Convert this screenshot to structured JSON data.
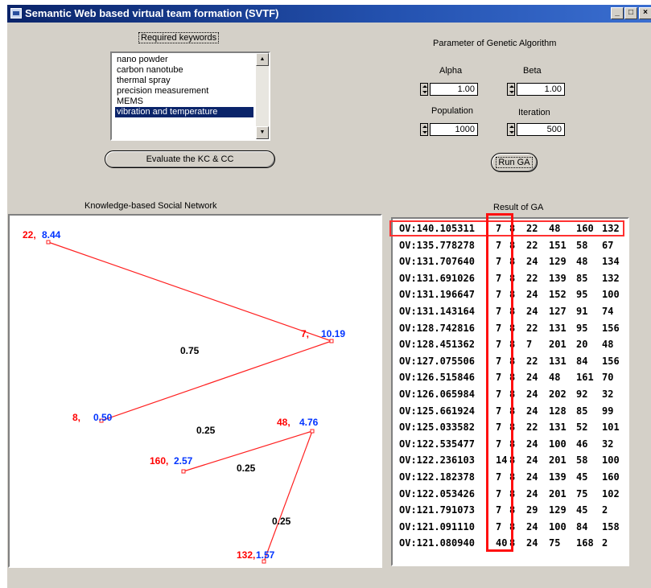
{
  "window": {
    "title": "Semantic Web based virtual team formation (SVTF)",
    "controls": {
      "minimize": "_",
      "maximize": "□",
      "close": "×"
    }
  },
  "keywords": {
    "label": "Required keywords",
    "items": [
      "nano powder",
      "carbon nanotube",
      "thermal spray",
      "precision measurement",
      "MEMS",
      "vibration and temperature"
    ],
    "selected_index": 5
  },
  "evaluate_button": "Evaluate the KC & CC",
  "ga_params": {
    "title": "Parameter of Genetic Algorithm",
    "alpha_label": "Alpha",
    "alpha_value": "1.00",
    "beta_label": "Beta",
    "beta_value": "1.00",
    "population_label": "Population",
    "population_value": "1000",
    "iteration_label": "Iteration",
    "iteration_value": "500"
  },
  "run_button": "Run GA",
  "network": {
    "title": "Knowledge-based Social Network",
    "colors": {
      "edge": "#ff2020",
      "id": "#ff0000",
      "score": "#0033ff",
      "weight": "#000000"
    },
    "nodes": [
      {
        "id": "22,",
        "score": "8.44"
      },
      {
        "id": "7,",
        "score": "10.19"
      },
      {
        "id": "8,",
        "score": "0.50"
      },
      {
        "id": "48,",
        "score": "4.76"
      },
      {
        "id": "160,",
        "score": "2.57"
      },
      {
        "id": "132,",
        "score": "1.57"
      }
    ],
    "edges": [
      {
        "from": 0,
        "to": 1,
        "weight": "0.75"
      },
      {
        "from": 1,
        "to": 2,
        "weight": "0.25"
      },
      {
        "from": 3,
        "to": 4,
        "weight": "0.25"
      },
      {
        "from": 3,
        "to": 5,
        "weight": "0.25"
      }
    ]
  },
  "results": {
    "title": "Result of GA",
    "rows": [
      [
        "OV:140.105311",
        "7",
        "8",
        "22",
        "48",
        "160",
        "132"
      ],
      [
        "OV:135.778278",
        "7",
        "8",
        "22",
        "151",
        "58",
        "67"
      ],
      [
        "OV:131.707640",
        "7",
        "8",
        "24",
        "129",
        "48",
        "134"
      ],
      [
        "OV:131.691026",
        "7",
        "8",
        "22",
        "139",
        "85",
        "132"
      ],
      [
        "OV:131.196647",
        "7",
        "8",
        "24",
        "152",
        "95",
        "100"
      ],
      [
        "OV:131.143164",
        "7",
        "8",
        "24",
        "127",
        "91",
        "74"
      ],
      [
        "OV:128.742816",
        "7",
        "8",
        "22",
        "131",
        "95",
        "156"
      ],
      [
        "OV:128.451362",
        "7",
        "8",
        "7",
        "201",
        "20",
        "48"
      ],
      [
        "OV:127.075506",
        "7",
        "8",
        "22",
        "131",
        "84",
        "156"
      ],
      [
        "OV:126.515846",
        "7",
        "8",
        "24",
        "48",
        "161",
        "70"
      ],
      [
        "OV:126.065984",
        "7",
        "8",
        "24",
        "202",
        "92",
        "32"
      ],
      [
        "OV:125.661924",
        "7",
        "8",
        "24",
        "128",
        "85",
        "99"
      ],
      [
        "OV:125.033582",
        "7",
        "8",
        "22",
        "131",
        "52",
        "101"
      ],
      [
        "OV:122.535477",
        "7",
        "8",
        "24",
        "100",
        "46",
        "32"
      ],
      [
        "OV:122.236103",
        "14",
        "8",
        "24",
        "201",
        "58",
        "100"
      ],
      [
        "OV:122.182378",
        "7",
        "8",
        "24",
        "139",
        "45",
        "160"
      ],
      [
        "OV:122.053426",
        "7",
        "8",
        "24",
        "201",
        "75",
        "102"
      ],
      [
        "OV:121.791073",
        "7",
        "8",
        "29",
        "129",
        "45",
        "2"
      ],
      [
        "OV:121.091110",
        "7",
        "8",
        "24",
        "100",
        "84",
        "158"
      ],
      [
        "OV:121.080940",
        "40",
        "8",
        "24",
        "75",
        "168",
        "2"
      ]
    ],
    "highlight_color": "#ff1010"
  }
}
